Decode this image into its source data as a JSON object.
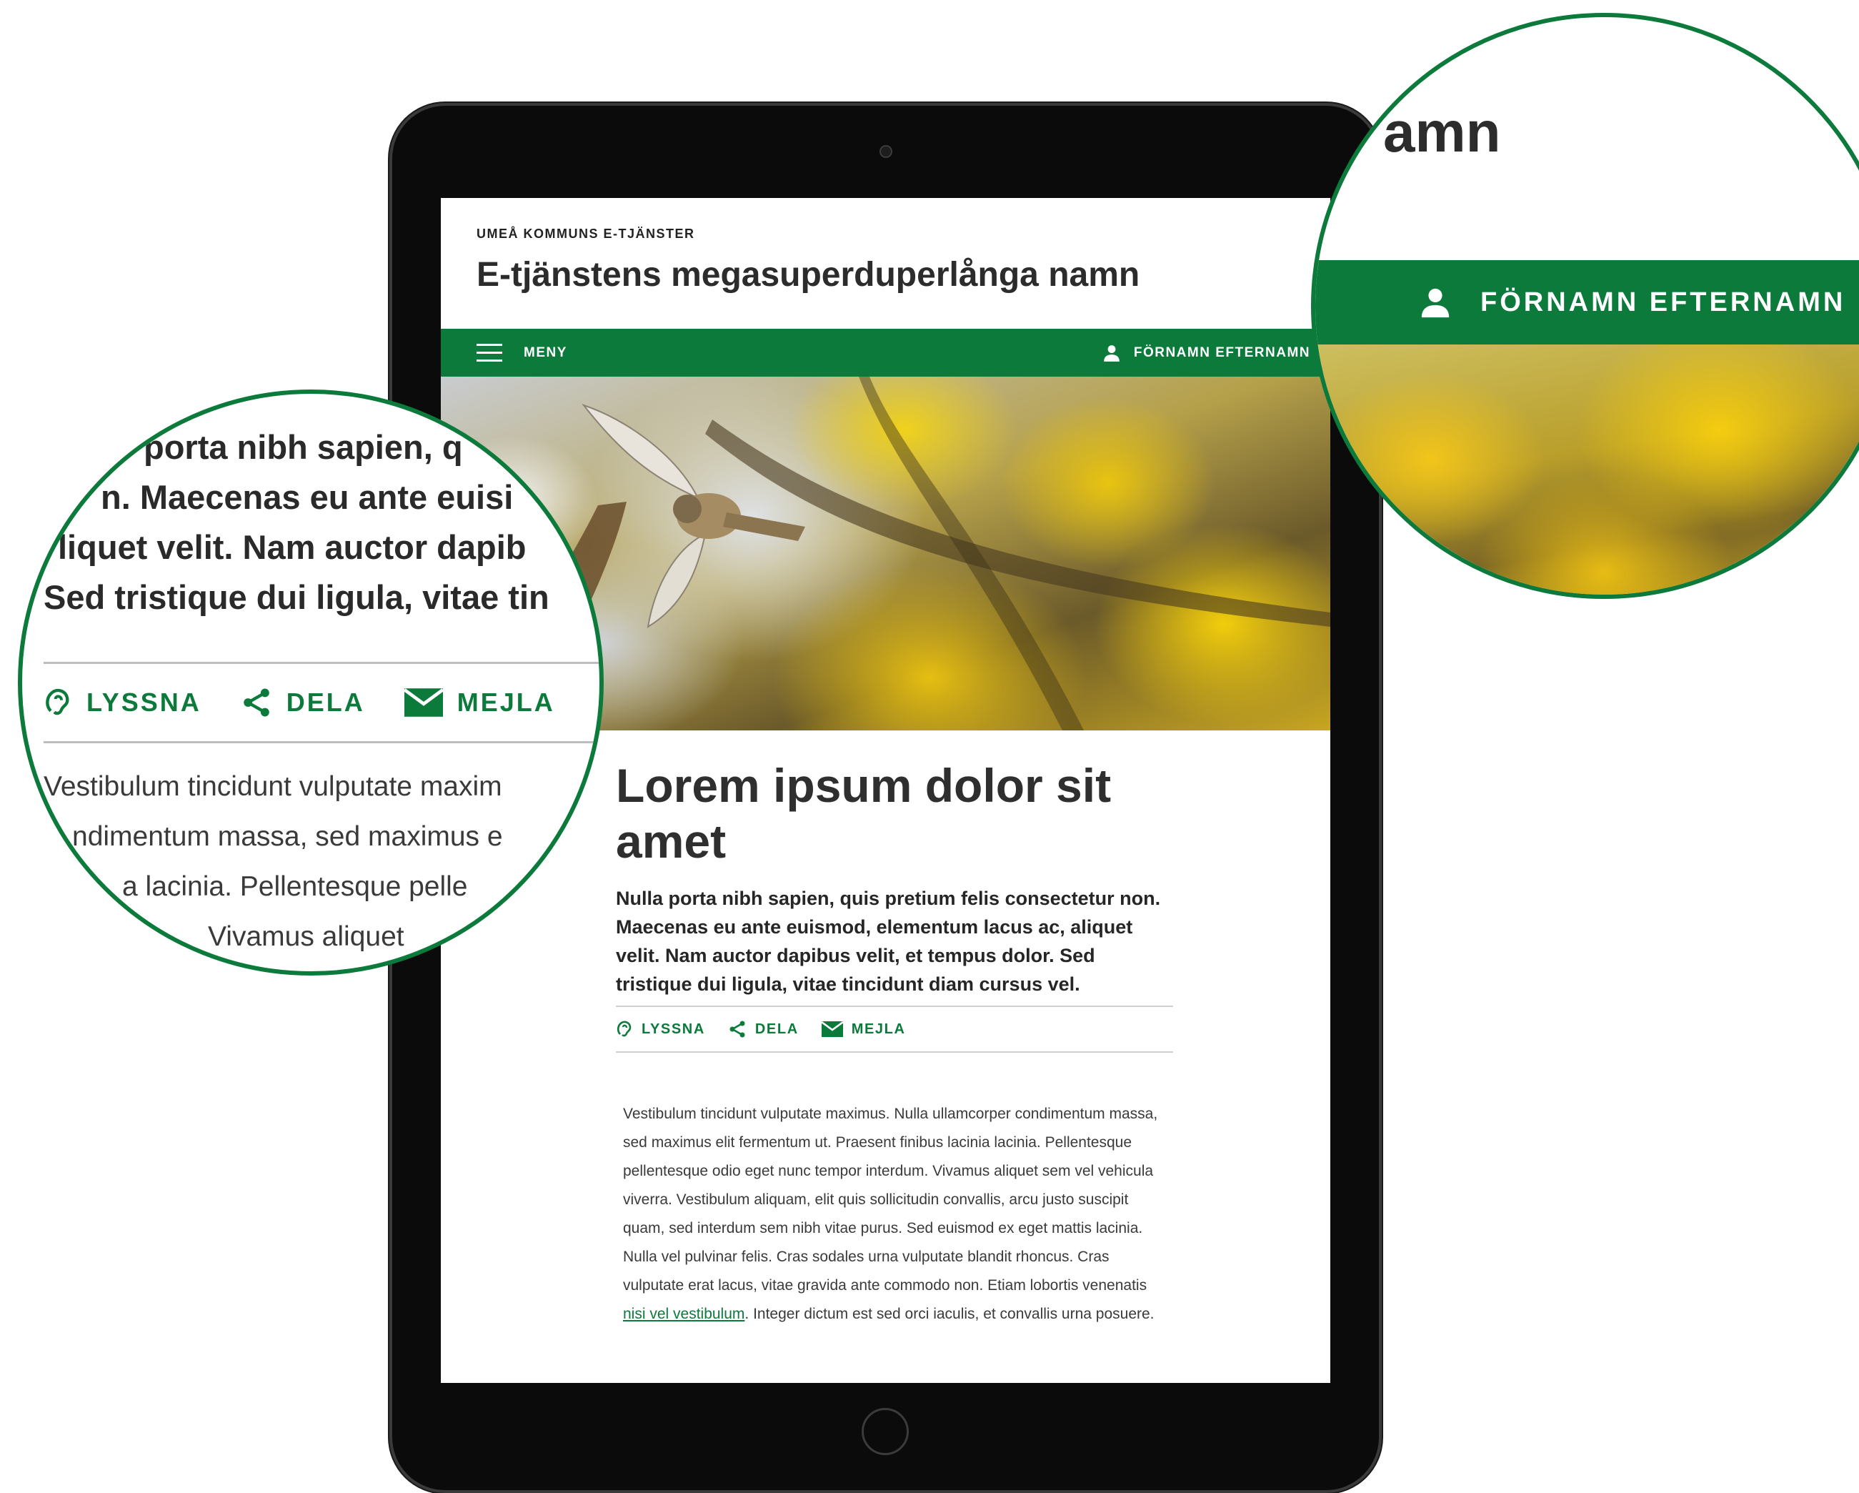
{
  "header": {
    "org_name": "UMEÅ KOMMUNS E-TJÄNSTER",
    "service_title": "E-tjänstens megasuperduperlånga namn"
  },
  "nav": {
    "menu_label": "MENY",
    "user_label": "FÖRNAMN EFTERNAMN"
  },
  "article": {
    "title": "Lorem ipsum dolor sit amet",
    "lead": "Nulla porta nibh sapien, quis pretium felis consectetur non. Maecenas eu ante euismod, elementum lacus ac, aliquet velit. Nam auctor dapibus velit, et tempus dolor. Sed tristique dui ligula, vitae tincidunt diam cursus vel.",
    "actions": {
      "listen": "LYSSNA",
      "share": "DELA",
      "email": "MEJLA"
    },
    "body_before_link": "Vestibulum tincidunt vulputate maximus. Nulla ullamcorper condimentum massa, sed maximus elit fermentum ut. Praesent finibus lacinia lacinia. Pellentesque pellentesque odio eget nunc tempor interdum. Vivamus aliquet sem vel vehicula viverra. Vestibulum aliquam, elit quis sollicitudin convallis, arcu justo suscipit quam, sed interdum sem nibh vitae purus. Sed euismod ex eget mattis lacinia. Nulla vel pulvinar felis. Cras sodales urna vulputate blandit rhoncus. Cras vulputate erat lacus, vitae gravida ante commodo non. Etiam lobortis venenatis ",
    "body_link": "nisi vel vestibulum",
    "body_after_link": ". Integer dictum est sed orci iaculis, et convallis urna posuere."
  },
  "zoom_left": {
    "lead_lines": [
      "porta nibh sapien, q",
      "n. Maecenas eu ante euisi",
      "liquet velit. Nam auctor dapib",
      "Sed tristique dui ligula, vitae tin"
    ],
    "body_lines": [
      "Vestibulum tincidunt vulputate maxim",
      "ndimentum massa, sed maximus e",
      "a lacinia. Pellentesque pelle",
      "Vivamus aliquet"
    ]
  },
  "zoom_right": {
    "title_fragment": "amn",
    "user_label": "FÖRNAMN EFTERNAMN"
  },
  "colors": {
    "brand_green": "#0b7a3b",
    "text_dark": "#2b2b2b"
  },
  "icons": [
    "menu-icon",
    "user-icon",
    "listen-icon",
    "share-icon",
    "mail-icon",
    "camera",
    "home-button"
  ]
}
